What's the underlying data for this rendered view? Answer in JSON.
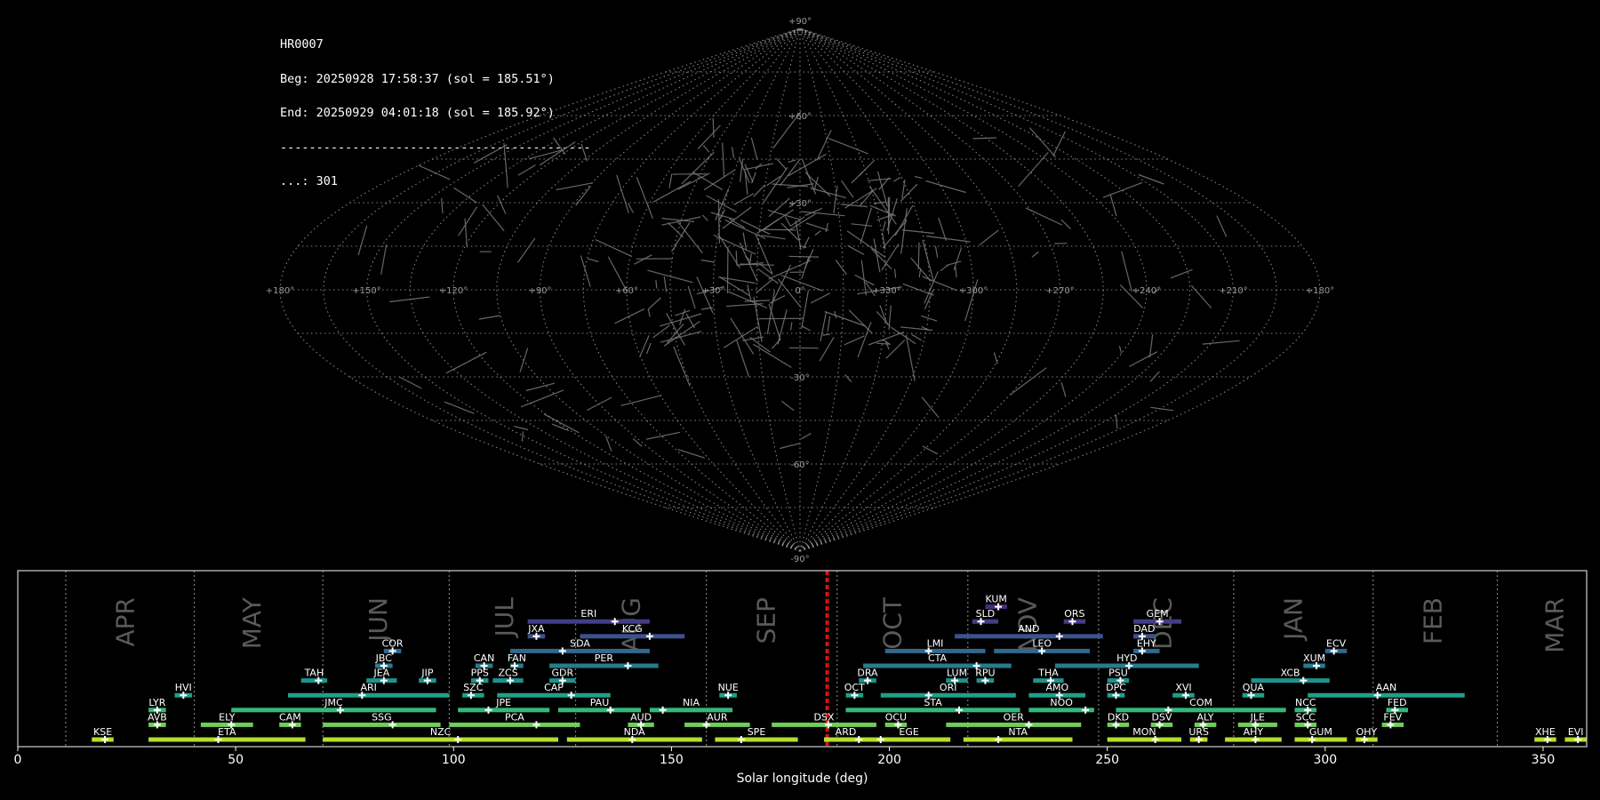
{
  "info": {
    "station": "HR0007",
    "beg": "Beg: 20250928 17:58:37 (sol = 185.51°)",
    "end": "End: 20250929 04:01:18 (sol = 185.92°)",
    "sep": "-------------------------------------------",
    "count": "...: 301"
  },
  "sky_map": {
    "projection": "sinusoidal",
    "lon_labels": [
      "+180°",
      "+150°",
      "+120°",
      "+90°",
      "+60°",
      "+30°",
      "0°",
      "+330°",
      "+300°",
      "+270°",
      "+240°",
      "+210°",
      "+180°"
    ],
    "lat_labels": [
      "+90°",
      "+60°",
      "+30°",
      "-30°",
      "-60°",
      "-90°"
    ],
    "grid_color": "#9a9a9a",
    "track_color": "#7a7a7a"
  },
  "chart_data": {
    "type": "timeline",
    "xlabel": "Solar longitude (deg)",
    "xlim": [
      0,
      360
    ],
    "xticks": [
      0,
      50,
      100,
      150,
      200,
      250,
      300,
      350
    ],
    "current_sol": [
      185.51,
      185.92
    ],
    "months": [
      {
        "name": "APR",
        "center": 25
      },
      {
        "name": "MAY",
        "center": 54
      },
      {
        "name": "JUN",
        "center": 83
      },
      {
        "name": "JUL",
        "center": 112
      },
      {
        "name": "AUG",
        "center": 141
      },
      {
        "name": "SEP",
        "center": 172
      },
      {
        "name": "OCT",
        "center": 201
      },
      {
        "name": "NOV",
        "center": 232
      },
      {
        "name": "DEC",
        "center": 263
      },
      {
        "name": "JAN",
        "center": 293
      },
      {
        "name": "FEB",
        "center": 325
      },
      {
        "name": "MAR",
        "center": 353
      }
    ],
    "month_boundaries": [
      11,
      40.5,
      70,
      99,
      128,
      158,
      188,
      218,
      248,
      279,
      311,
      339.5
    ],
    "showers": [
      {
        "code": "KUM",
        "start": 222,
        "end": 227,
        "peak": 225,
        "row": 10,
        "color": "#472d7b"
      },
      {
        "code": "ERI",
        "start": 117,
        "end": 145,
        "peak": 137,
        "row": 9,
        "color": "#433e85"
      },
      {
        "code": "SLD",
        "start": 219,
        "end": 225,
        "peak": 221,
        "row": 9,
        "color": "#433e85"
      },
      {
        "code": "ORS",
        "start": 240,
        "end": 245,
        "peak": 242,
        "row": 9,
        "color": "#433e85"
      },
      {
        "code": "GEM",
        "start": 256,
        "end": 267,
        "peak": 262,
        "row": 9,
        "color": "#433e85"
      },
      {
        "code": "JXA",
        "start": 117,
        "end": 121,
        "peak": 119,
        "row": 8,
        "color": "#3b528b"
      },
      {
        "code": "KCG",
        "start": 129,
        "end": 153,
        "peak": 145,
        "row": 8,
        "color": "#3b528b"
      },
      {
        "code": "AND",
        "start": 215,
        "end": 249,
        "peak": 239,
        "row": 8,
        "color": "#3b528b"
      },
      {
        "code": "DAD",
        "start": 256,
        "end": 261,
        "peak": 258,
        "row": 8,
        "color": "#3b528b"
      },
      {
        "code": "COR",
        "start": 84,
        "end": 88,
        "peak": 86,
        "row": 7,
        "color": "#31688e"
      },
      {
        "code": "SDA",
        "start": 113,
        "end": 145,
        "peak": 125,
        "row": 7,
        "color": "#31688e"
      },
      {
        "code": "LMI",
        "start": 199,
        "end": 222,
        "peak": 209,
        "row": 7,
        "color": "#31688e"
      },
      {
        "code": "LEO",
        "start": 224,
        "end": 246,
        "peak": 235,
        "row": 7,
        "color": "#31688e"
      },
      {
        "code": "EHY",
        "start": 256,
        "end": 262,
        "peak": 258,
        "row": 7,
        "color": "#31688e"
      },
      {
        "code": "ECV",
        "start": 300,
        "end": 305,
        "peak": 302,
        "row": 7,
        "color": "#31688e"
      },
      {
        "code": "JBC",
        "start": 82,
        "end": 86,
        "peak": 84,
        "row": 6,
        "color": "#287c8e"
      },
      {
        "code": "CAN",
        "start": 105,
        "end": 109,
        "peak": 107,
        "row": 6,
        "color": "#287c8e"
      },
      {
        "code": "FAN",
        "start": 113,
        "end": 116,
        "peak": 114,
        "row": 6,
        "color": "#287c8e"
      },
      {
        "code": "PER",
        "start": 122,
        "end": 147,
        "peak": 140,
        "row": 6,
        "color": "#287c8e"
      },
      {
        "code": "CTA",
        "start": 194,
        "end": 228,
        "peak": 220,
        "row": 6,
        "color": "#287c8e"
      },
      {
        "code": "HYD",
        "start": 238,
        "end": 271,
        "peak": 255,
        "row": 6,
        "color": "#287c8e"
      },
      {
        "code": "XUM",
        "start": 295,
        "end": 300,
        "peak": 298,
        "row": 6,
        "color": "#287c8e"
      },
      {
        "code": "TAH",
        "start": 65,
        "end": 71,
        "peak": 69,
        "row": 5,
        "color": "#21918c"
      },
      {
        "code": "JEA",
        "start": 80,
        "end": 87,
        "peak": 84,
        "row": 5,
        "color": "#21918c"
      },
      {
        "code": "JIP",
        "start": 92,
        "end": 96,
        "peak": 94,
        "row": 5,
        "color": "#21918c"
      },
      {
        "code": "PPS",
        "start": 104,
        "end": 108,
        "peak": 106,
        "row": 5,
        "color": "#21918c"
      },
      {
        "code": "ZCS",
        "start": 109,
        "end": 116,
        "peak": 113,
        "row": 5,
        "color": "#21918c"
      },
      {
        "code": "GDR",
        "start": 122,
        "end": 128,
        "peak": 125,
        "row": 5,
        "color": "#21918c"
      },
      {
        "code": "DRA",
        "start": 193,
        "end": 197,
        "peak": 195,
        "row": 5,
        "color": "#21918c"
      },
      {
        "code": "LUM",
        "start": 213,
        "end": 218,
        "peak": 215,
        "row": 5,
        "color": "#21918c"
      },
      {
        "code": "RPU",
        "start": 220,
        "end": 224,
        "peak": 222,
        "row": 5,
        "color": "#21918c"
      },
      {
        "code": "THA",
        "start": 233,
        "end": 240,
        "peak": 237,
        "row": 5,
        "color": "#21918c"
      },
      {
        "code": "PSU",
        "start": 250,
        "end": 255,
        "peak": 253,
        "row": 5,
        "color": "#21918c"
      },
      {
        "code": "XCB",
        "start": 283,
        "end": 301,
        "peak": 295,
        "row": 5,
        "color": "#21918c"
      },
      {
        "code": "HVI",
        "start": 36,
        "end": 40,
        "peak": 38,
        "row": 4,
        "color": "#1fa088"
      },
      {
        "code": "ARI",
        "start": 62,
        "end": 99,
        "peak": 79,
        "row": 4,
        "color": "#1fa088"
      },
      {
        "code": "SZC",
        "start": 102,
        "end": 107,
        "peak": 104,
        "row": 4,
        "color": "#1fa088"
      },
      {
        "code": "CAP",
        "start": 110,
        "end": 136,
        "peak": 127,
        "row": 4,
        "color": "#1fa088"
      },
      {
        "code": "NUE",
        "start": 161,
        "end": 165,
        "peak": 163,
        "row": 4,
        "color": "#1fa088"
      },
      {
        "code": "OCT",
        "start": 190,
        "end": 194,
        "peak": 192,
        "row": 4,
        "color": "#1fa088"
      },
      {
        "code": "ORI",
        "start": 198,
        "end": 229,
        "peak": 209,
        "row": 4,
        "color": "#1fa088"
      },
      {
        "code": "AMO",
        "start": 232,
        "end": 245,
        "peak": 239,
        "row": 4,
        "color": "#1fa088"
      },
      {
        "code": "DPC",
        "start": 250,
        "end": 254,
        "peak": 252,
        "row": 4,
        "color": "#1fa088"
      },
      {
        "code": "XVI",
        "start": 265,
        "end": 270,
        "peak": 268,
        "row": 4,
        "color": "#1fa088"
      },
      {
        "code": "QUA",
        "start": 281,
        "end": 286,
        "peak": 283,
        "row": 4,
        "color": "#1fa088"
      },
      {
        "code": "AAN",
        "start": 296,
        "end": 332,
        "peak": 312,
        "row": 4,
        "color": "#1fa088"
      },
      {
        "code": "LYR",
        "start": 30,
        "end": 34,
        "peak": 32,
        "row": 3,
        "color": "#35b779"
      },
      {
        "code": "JMC",
        "start": 49,
        "end": 96,
        "peak": 74,
        "row": 3,
        "color": "#35b779"
      },
      {
        "code": "JPE",
        "start": 101,
        "end": 122,
        "peak": 108,
        "row": 3,
        "color": "#35b779"
      },
      {
        "code": "PAU",
        "start": 124,
        "end": 143,
        "peak": 136,
        "row": 3,
        "color": "#35b779"
      },
      {
        "code": "NIA",
        "start": 145,
        "end": 164,
        "peak": 148,
        "row": 3,
        "color": "#35b779"
      },
      {
        "code": "STA",
        "start": 190,
        "end": 230,
        "peak": 216,
        "row": 3,
        "color": "#35b779"
      },
      {
        "code": "NOO",
        "start": 232,
        "end": 247,
        "peak": 245,
        "row": 3,
        "color": "#35b779"
      },
      {
        "code": "COM",
        "start": 252,
        "end": 291,
        "peak": 264,
        "row": 3,
        "color": "#35b779"
      },
      {
        "code": "NCC",
        "start": 293,
        "end": 298,
        "peak": 296,
        "row": 3,
        "color": "#35b779"
      },
      {
        "code": "FED",
        "start": 314,
        "end": 319,
        "peak": 316,
        "row": 3,
        "color": "#35b779"
      },
      {
        "code": "AVB",
        "start": 30,
        "end": 34,
        "peak": 32,
        "row": 2,
        "color": "#6ece58"
      },
      {
        "code": "ELY",
        "start": 42,
        "end": 54,
        "peak": 49,
        "row": 2,
        "color": "#6ece58"
      },
      {
        "code": "CAM",
        "start": 60,
        "end": 65,
        "peak": 63,
        "row": 2,
        "color": "#6ece58"
      },
      {
        "code": "SSG",
        "start": 70,
        "end": 97,
        "peak": 86,
        "row": 2,
        "color": "#6ece58"
      },
      {
        "code": "PCA",
        "start": 99,
        "end": 129,
        "peak": 119,
        "row": 2,
        "color": "#6ece58"
      },
      {
        "code": "AUD",
        "start": 140,
        "end": 146,
        "peak": 143,
        "row": 2,
        "color": "#6ece58"
      },
      {
        "code": "AUR",
        "start": 153,
        "end": 168,
        "peak": 158,
        "row": 2,
        "color": "#6ece58"
      },
      {
        "code": "DSX",
        "start": 173,
        "end": 197,
        "peak": 186,
        "row": 2,
        "color": "#6ece58"
      },
      {
        "code": "OCU",
        "start": 199,
        "end": 204,
        "peak": 202,
        "row": 2,
        "color": "#6ece58"
      },
      {
        "code": "OER",
        "start": 213,
        "end": 244,
        "peak": 232,
        "row": 2,
        "color": "#6ece58"
      },
      {
        "code": "DKD",
        "start": 250,
        "end": 255,
        "peak": 252,
        "row": 2,
        "color": "#6ece58"
      },
      {
        "code": "DSV",
        "start": 260,
        "end": 265,
        "peak": 262,
        "row": 2,
        "color": "#6ece58"
      },
      {
        "code": "ALY",
        "start": 270,
        "end": 275,
        "peak": 272,
        "row": 2,
        "color": "#6ece58"
      },
      {
        "code": "JLE",
        "start": 280,
        "end": 289,
        "peak": 284,
        "row": 2,
        "color": "#6ece58"
      },
      {
        "code": "SCC",
        "start": 293,
        "end": 298,
        "peak": 296,
        "row": 2,
        "color": "#6ece58"
      },
      {
        "code": "FEV",
        "start": 313,
        "end": 318,
        "peak": 315,
        "row": 2,
        "color": "#6ece58"
      },
      {
        "code": "KSE",
        "start": 17,
        "end": 22,
        "peak": 20,
        "row": 1,
        "color": "#b5de2b"
      },
      {
        "code": "ETA",
        "start": 30,
        "end": 66,
        "peak": 46,
        "row": 1,
        "color": "#b5de2b"
      },
      {
        "code": "NZC",
        "start": 70,
        "end": 124,
        "peak": 101,
        "row": 1,
        "color": "#b5de2b"
      },
      {
        "code": "NDA",
        "start": 126,
        "end": 157,
        "peak": 141,
        "row": 1,
        "color": "#b5de2b"
      },
      {
        "code": "SPE",
        "start": 160,
        "end": 179,
        "peak": 166,
        "row": 1,
        "color": "#b5de2b"
      },
      {
        "code": "ARD",
        "start": 185,
        "end": 195,
        "peak": 193,
        "row": 1,
        "color": "#b5de2b"
      },
      {
        "code": "EGE",
        "start": 195,
        "end": 214,
        "peak": 198,
        "row": 1,
        "color": "#b5de2b"
      },
      {
        "code": "NTA",
        "start": 217,
        "end": 242,
        "peak": 225,
        "row": 1,
        "color": "#b5de2b"
      },
      {
        "code": "MON",
        "start": 250,
        "end": 267,
        "peak": 261,
        "row": 1,
        "color": "#b5de2b"
      },
      {
        "code": "URS",
        "start": 269,
        "end": 273,
        "peak": 271,
        "row": 1,
        "color": "#b5de2b"
      },
      {
        "code": "AHY",
        "start": 277,
        "end": 290,
        "peak": 284,
        "row": 1,
        "color": "#b5de2b"
      },
      {
        "code": "GUM",
        "start": 293,
        "end": 305,
        "peak": 297,
        "row": 1,
        "color": "#b5de2b"
      },
      {
        "code": "OHY",
        "start": 307,
        "end": 312,
        "peak": 309,
        "row": 1,
        "color": "#b5de2b"
      },
      {
        "code": "XHE",
        "start": 348,
        "end": 353,
        "peak": 351,
        "row": 1,
        "color": "#b5de2b"
      },
      {
        "code": "EVI",
        "start": 355,
        "end": 360,
        "peak": 358,
        "row": 1,
        "color": "#b5de2b"
      }
    ]
  }
}
